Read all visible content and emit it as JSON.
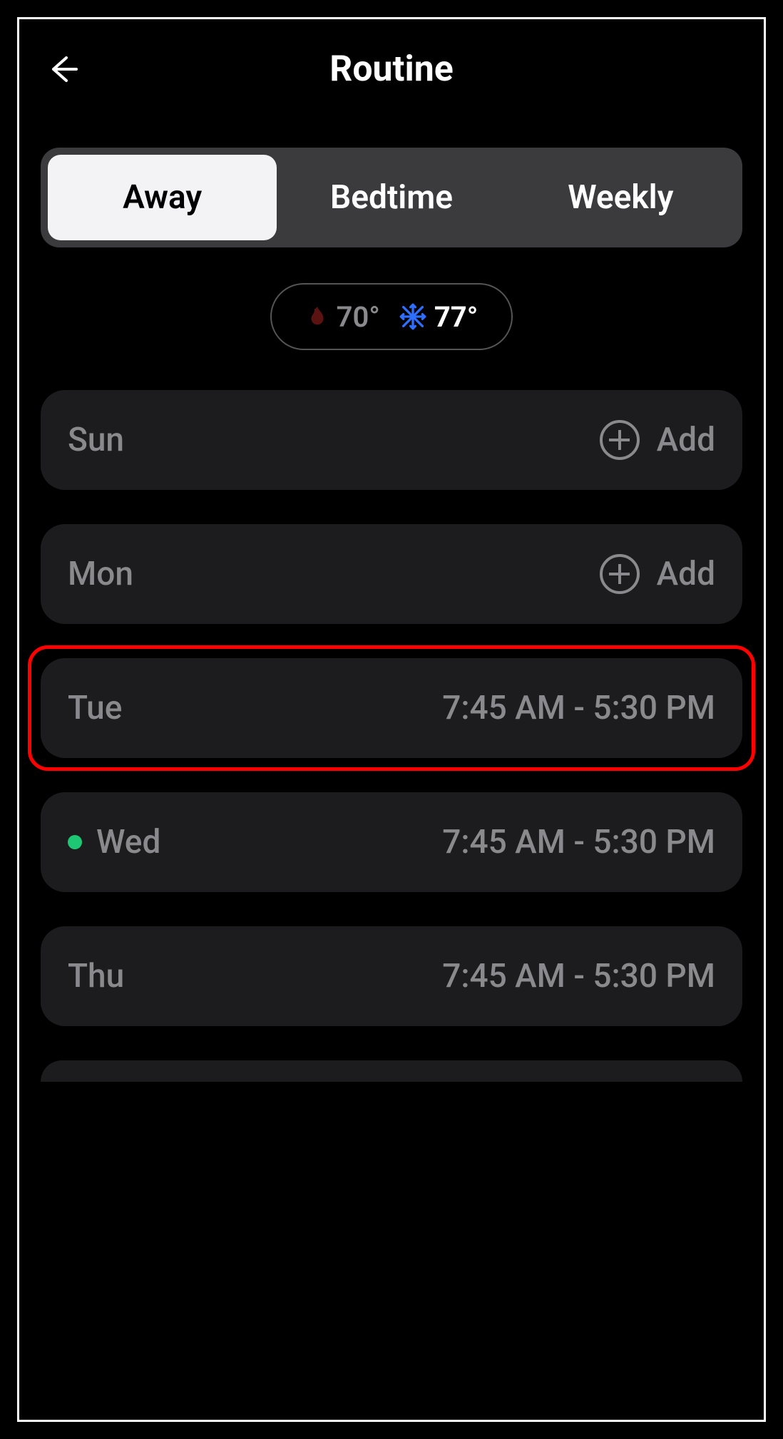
{
  "header": {
    "title": "Routine"
  },
  "tabs": [
    {
      "id": "away",
      "label": "Away",
      "active": true
    },
    {
      "id": "bedtime",
      "label": "Bedtime",
      "active": false
    },
    {
      "id": "weekly",
      "label": "Weekly",
      "active": false
    }
  ],
  "temperature": {
    "heat": {
      "value": "70°",
      "color": "#5a1310"
    },
    "cool": {
      "value": "77°",
      "color": "#2f6fff"
    }
  },
  "add_label": "Add",
  "days": [
    {
      "key": "sun",
      "label": "Sun",
      "time": null,
      "active": false,
      "highlighted": false
    },
    {
      "key": "mon",
      "label": "Mon",
      "time": null,
      "active": false,
      "highlighted": false
    },
    {
      "key": "tue",
      "label": "Tue",
      "time": "7:45 AM - 5:30 PM",
      "active": false,
      "highlighted": true
    },
    {
      "key": "wed",
      "label": "Wed",
      "time": "7:45 AM - 5:30 PM",
      "active": true,
      "highlighted": false
    },
    {
      "key": "thu",
      "label": "Thu",
      "time": "7:45 AM - 5:30 PM",
      "active": false,
      "highlighted": false
    }
  ]
}
